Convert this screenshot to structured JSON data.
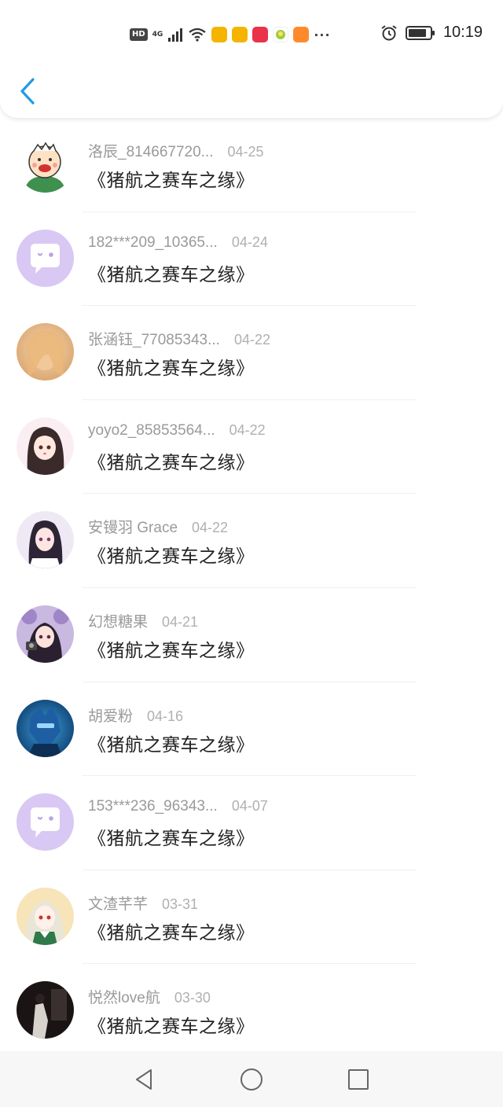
{
  "status_bar": {
    "hd": "HD",
    "network": "4G",
    "dots": "···",
    "time": "10:19"
  },
  "header": {
    "back_icon": "chevron-left-icon"
  },
  "items": [
    {
      "name": "洛辰_814667720...",
      "date": "04-25",
      "title": "《猪航之赛车之缘》"
    },
    {
      "name": "182***209_10365...",
      "date": "04-24",
      "title": "《猪航之赛车之缘》"
    },
    {
      "name": "张涵钰_77085343...",
      "date": "04-22",
      "title": "《猪航之赛车之缘》"
    },
    {
      "name": "yoyo2_85853564...",
      "date": "04-22",
      "title": "《猪航之赛车之缘》"
    },
    {
      "name": "安镘羽 Grace",
      "date": "04-22",
      "title": "《猪航之赛车之缘》"
    },
    {
      "name": "幻想糖果",
      "date": "04-21",
      "title": "《猪航之赛车之缘》"
    },
    {
      "name": "胡爱粉",
      "date": "04-16",
      "title": "《猪航之赛车之缘》"
    },
    {
      "name": "153***236_96343...",
      "date": "04-07",
      "title": "《猪航之赛车之缘》"
    },
    {
      "name": "文渣芊芊",
      "date": "03-31",
      "title": "《猪航之赛车之缘》"
    },
    {
      "name": "悦然love航",
      "date": "03-30",
      "title": "《猪航之赛车之缘》"
    }
  ],
  "colors": {
    "accent": "#1e9be6",
    "default_avatar": "#d9c8f3"
  },
  "nav": {
    "back": "triangle-back-icon",
    "home": "circle-home-icon",
    "recents": "square-recents-icon"
  }
}
